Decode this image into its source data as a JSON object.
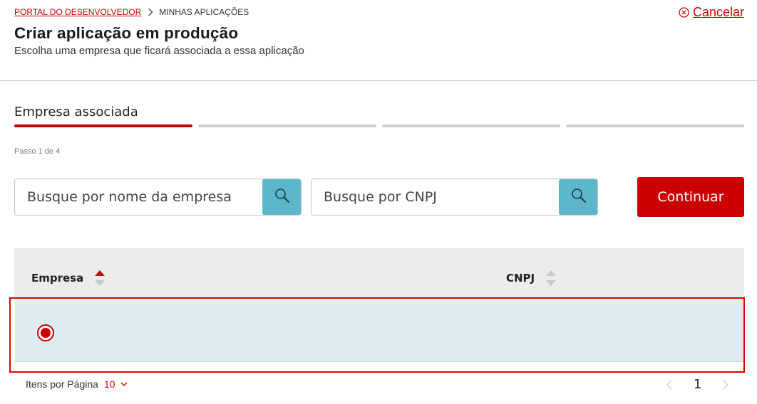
{
  "breadcrumb": {
    "link": "PORTAL DO DESENVOLVEDOR",
    "current": "MINHAS APLICAÇÕES"
  },
  "header": {
    "cancel_label": "Cancelar",
    "title": "Criar aplicação em produção",
    "subtitle": "Escolha uma empresa que ficará associada a essa aplicação"
  },
  "steps": {
    "current_label": "Empresa associada",
    "counter": "Passo 1 de 4",
    "total": 4,
    "active_index": 1
  },
  "search": {
    "name_placeholder": "Busque por nome da empresa",
    "cnpj_placeholder": "Busque por CNPJ"
  },
  "actions": {
    "continue_label": "Continuar"
  },
  "table": {
    "columns": [
      "Empresa",
      "CNPJ"
    ],
    "rows": [
      {
        "selected": true,
        "empresa": "",
        "cnpj": ""
      }
    ]
  },
  "pagination": {
    "per_page_label": "Itens por Página",
    "per_page_value": "10",
    "current_page": "1"
  },
  "colors": {
    "brand_red": "#cc0000",
    "search_button": "#5bb7c9",
    "selected_row": "#dcecf0"
  },
  "icons": [
    "chevron-right-icon",
    "close-circle-icon",
    "search-icon",
    "sort-icon",
    "chevron-down-icon",
    "chevron-left-icon"
  ]
}
